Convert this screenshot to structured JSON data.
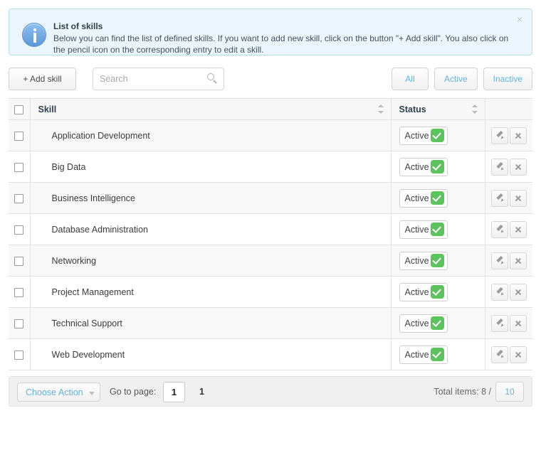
{
  "alert": {
    "icon": "info-circle-icon",
    "title": "List of skills",
    "text": "Below you can find the list of defined skills. If you want to add new skill, click on the button \"+ Add skill\". You also click on the pencil icon on the corresponding entry to edit a skill.",
    "close_label": "×"
  },
  "toolbar": {
    "add_label": "+ Add skill",
    "search_placeholder": "Search",
    "search_value": "",
    "search_icon": "search-icon",
    "filters": [
      {
        "label": "All"
      },
      {
        "label": "Active"
      },
      {
        "label": "Inactive"
      }
    ]
  },
  "table": {
    "columns": {
      "skill": "Skill",
      "status": "Status"
    },
    "rows": [
      {
        "skill": "Application Development",
        "status": "Active"
      },
      {
        "skill": "Big Data",
        "status": "Active"
      },
      {
        "skill": "Business Intelligence",
        "status": "Active"
      },
      {
        "skill": "Database Administration",
        "status": "Active"
      },
      {
        "skill": "Networking",
        "status": "Active"
      },
      {
        "skill": "Project Management",
        "status": "Active"
      },
      {
        "skill": "Technical Support",
        "status": "Active"
      },
      {
        "skill": "Web Development",
        "status": "Active"
      }
    ]
  },
  "footer": {
    "action_label": "Choose Action",
    "goto_label": "Go to page:",
    "goto_value": "1",
    "page_count": "1",
    "total_label": "Total items: 8 /",
    "page_size": "10"
  },
  "colors": {
    "alert_bg": "#eaf6fb",
    "alert_border": "#b7e0ef",
    "link_blue": "#5fb2e0",
    "status_green": "#5cc45c",
    "row_alt": "#f8f8f8",
    "footer_bg": "#f0f0f0"
  }
}
